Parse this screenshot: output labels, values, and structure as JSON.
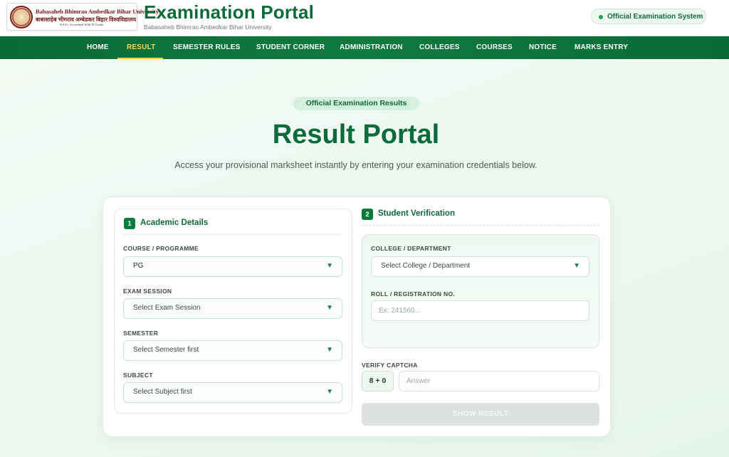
{
  "header": {
    "logo": {
      "line1": "Babasaheb Bhimrao Ambedkar Bihar University",
      "line2": "बाबासाहेब भीमराव अम्बेडकर बिहार विश्वविद्यालय",
      "line3": "NAAC Accredited With 'B' Grade"
    },
    "title": "Examination Portal",
    "subtitle": "Babasaheb Bhimrao Ambedkar Bihar University",
    "status_label": "Official Examination System"
  },
  "nav": {
    "items": [
      "HOME",
      "RESULT",
      "SEMESTER RULES",
      "STUDENT CORNER",
      "ADMINISTRATION",
      "COLLEGES",
      "COURSES",
      "NOTICE",
      "MARKS ENTRY"
    ],
    "active": "RESULT"
  },
  "hero": {
    "badge": "Official Examination Results",
    "title": "Result Portal",
    "description": "Access your provisional marksheet instantly by entering your examination credentials below."
  },
  "form": {
    "academic": {
      "step": "1",
      "title": "Academic Details",
      "course": {
        "label": "COURSE / PROGRAMME",
        "value": "PG"
      },
      "session": {
        "label": "EXAM SESSION",
        "value": "Select Exam Session"
      },
      "semester": {
        "label": "SEMESTER",
        "value": "Select Semester first"
      },
      "subject": {
        "label": "SUBJECT",
        "value": "Select Subject first"
      }
    },
    "verification": {
      "step": "2",
      "title": "Student Verification",
      "college": {
        "label": "COLLEGE / DEPARTMENT",
        "value": "Select College / Department"
      },
      "roll": {
        "label": "ROLL / REGISTRATION NO.",
        "placeholder": "Ex: 241560..."
      },
      "captcha": {
        "label": "VERIFY CAPTCHA",
        "question": "8 + 0",
        "placeholder": "Answer"
      },
      "submit_label": "SHOW RESULT"
    }
  },
  "colors": {
    "brand_green": "#0d6b3b",
    "nav_green": "#0e7a3f",
    "active_yellow": "#ffd84a",
    "disabled_button": "#dde2df"
  },
  "icons": {
    "dropdown": "chevron-down-icon",
    "status": "status-dot-icon"
  }
}
